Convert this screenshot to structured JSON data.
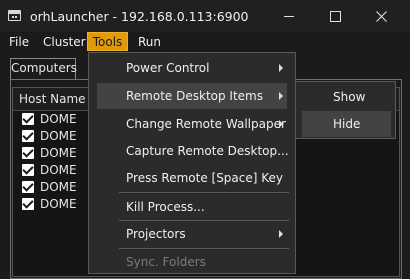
{
  "window": {
    "title": "orhLauncher - 192.168.0.113:6900"
  },
  "menubar": {
    "file": "File",
    "cluster": "Cluster",
    "tools": "Tools",
    "run": "Run"
  },
  "tabs": {
    "computers": "Computers"
  },
  "table": {
    "column_host": "Host Name",
    "rows": [
      {
        "name": "DOME",
        "checked": true
      },
      {
        "name": "DOME",
        "checked": true
      },
      {
        "name": "DOME",
        "checked": true
      },
      {
        "name": "DOME",
        "checked": true
      },
      {
        "name": "DOME",
        "checked": true
      },
      {
        "name": "DOME",
        "checked": true
      }
    ]
  },
  "tools_menu": {
    "items": [
      {
        "label": "Power Control",
        "submenu": true
      },
      {
        "label": "Remote Desktop Items",
        "submenu": true,
        "highlighted": true
      },
      {
        "label": "Change Remote Wallpaper",
        "submenu": true
      },
      {
        "label": "Capture Remote Desktop..."
      },
      {
        "label": "Press Remote [Space] Key"
      },
      {
        "label": "Kill Process..."
      },
      {
        "label": "Projectors",
        "submenu": true
      },
      {
        "label": "Sync. Folders",
        "disabled": true
      }
    ]
  },
  "remote_desktop_submenu": {
    "items": [
      {
        "label": "Show"
      },
      {
        "label": "Hide",
        "highlighted": true
      }
    ]
  },
  "icons": [
    "app-icon",
    "minimize-icon",
    "maximize-icon",
    "close-icon",
    "submenu-arrow-icon",
    "checkbox-checked-icon"
  ]
}
